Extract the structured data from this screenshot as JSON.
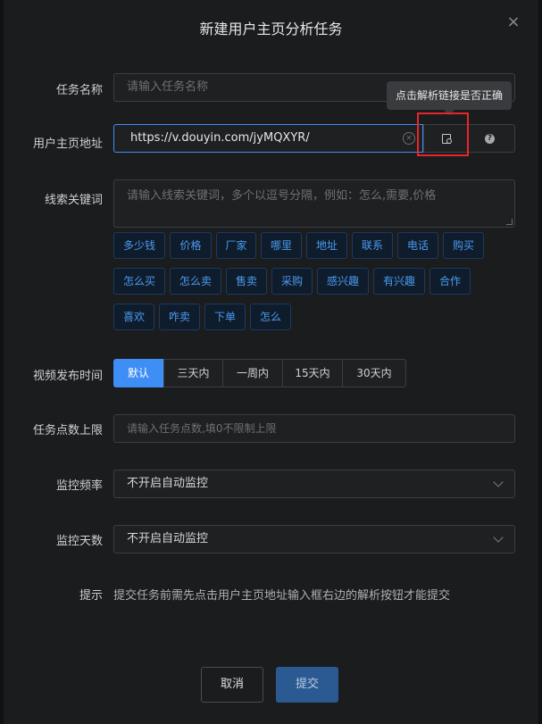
{
  "dialog": {
    "title": "新建用户主页分析任务",
    "close_icon": "×"
  },
  "form": {
    "task_name": {
      "label": "任务名称",
      "placeholder": "请输入任务名称"
    },
    "homepage_url": {
      "label": "用户主页地址",
      "value": "https://v.douyin.com/jyMQXYR/",
      "tooltip": "点击解析链接是否正确",
      "help_icon": "?"
    },
    "keywords": {
      "label": "线索关键词",
      "placeholder": "请输入线索关键词，多个以逗号分隔，例如：怎么,需要,价格",
      "tags": [
        "多少钱",
        "价格",
        "厂家",
        "哪里",
        "地址",
        "联系",
        "电话",
        "购买",
        "怎么买",
        "怎么卖",
        "售卖",
        "采购",
        "感兴趣",
        "有兴趣",
        "合作",
        "喜欢",
        "咋卖",
        "下单",
        "怎么"
      ]
    },
    "publish_time": {
      "label": "视频发布时间",
      "options": [
        "默认",
        "三天内",
        "一周内",
        "15天内",
        "30天内"
      ],
      "selected": "默认"
    },
    "points_limit": {
      "label": "任务点数上限",
      "placeholder": "请输入任务点数,填0不限制上限"
    },
    "monitor_freq": {
      "label": "监控频率",
      "value": "不开启自动监控"
    },
    "monitor_days": {
      "label": "监控天数",
      "value": "不开启自动监控"
    },
    "hint": {
      "label": "提示",
      "text": "提交任务前需先点击用户主页地址输入框右边的解析按钮才能提交"
    }
  },
  "buttons": {
    "cancel": "取消",
    "submit": "提交"
  },
  "colors": {
    "accent": "#3f8ef5",
    "tag_text": "#4a9bf0",
    "highlight": "#e8262a"
  }
}
